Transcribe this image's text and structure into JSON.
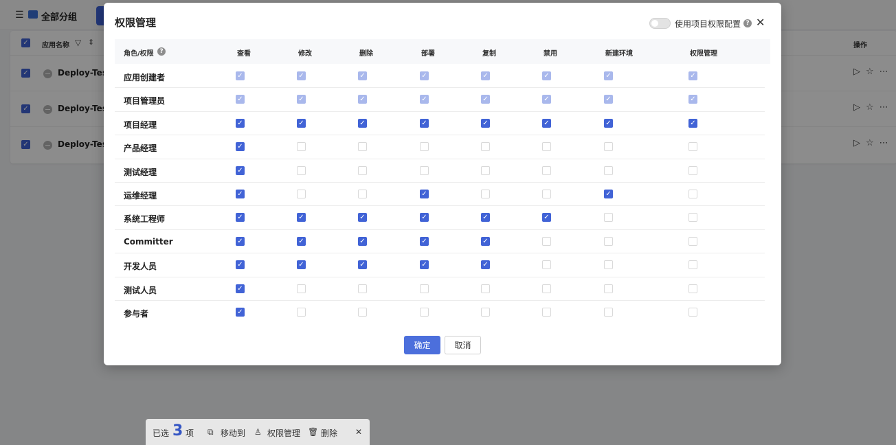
{
  "topbar": {
    "menu_icon": "☰",
    "group_label": "全部分组"
  },
  "list": {
    "col_name": "应用名称",
    "col_ops": "操作",
    "rows": [
      {
        "name": "Deploy-Test"
      },
      {
        "name": "Deploy-Test"
      },
      {
        "name": "Deploy-Test"
      }
    ]
  },
  "dialog": {
    "title": "权限管理",
    "toggle_label": "使用项目权限配置",
    "close_icon": "✕",
    "header_role": "角色/权限",
    "columns": [
      "查看",
      "修改",
      "删除",
      "部署",
      "复制",
      "禁用",
      "新建环境",
      "权限管理"
    ],
    "roles": [
      {
        "name": "应用创建者",
        "state": "disabled",
        "perms": [
          1,
          1,
          1,
          1,
          1,
          1,
          1,
          1
        ]
      },
      {
        "name": "项目管理员",
        "state": "disabled",
        "perms": [
          1,
          1,
          1,
          1,
          1,
          1,
          1,
          1
        ]
      },
      {
        "name": "项目经理",
        "state": "enabled",
        "perms": [
          1,
          1,
          1,
          1,
          1,
          1,
          1,
          1
        ]
      },
      {
        "name": "产品经理",
        "state": "enabled",
        "perms": [
          1,
          0,
          0,
          0,
          0,
          0,
          0,
          0
        ]
      },
      {
        "name": "测试经理",
        "state": "enabled",
        "perms": [
          1,
          0,
          0,
          0,
          0,
          0,
          0,
          0
        ]
      },
      {
        "name": "运维经理",
        "state": "enabled",
        "perms": [
          1,
          0,
          0,
          1,
          0,
          0,
          1,
          0
        ]
      },
      {
        "name": "系统工程师",
        "state": "enabled",
        "perms": [
          1,
          1,
          1,
          1,
          1,
          1,
          0,
          0
        ]
      },
      {
        "name": "Committer",
        "state": "enabled",
        "perms": [
          1,
          1,
          1,
          1,
          1,
          0,
          0,
          0
        ]
      },
      {
        "name": "开发人员",
        "state": "enabled",
        "perms": [
          1,
          1,
          1,
          1,
          1,
          0,
          0,
          0
        ]
      },
      {
        "name": "测试人员",
        "state": "enabled",
        "perms": [
          1,
          0,
          0,
          0,
          0,
          0,
          0,
          0
        ]
      },
      {
        "name": "参与者",
        "state": "enabled",
        "perms": [
          1,
          0,
          0,
          0,
          0,
          0,
          0,
          0
        ]
      }
    ],
    "ok_label": "确定",
    "cancel_label": "取消"
  },
  "selection_bar": {
    "prefix": "已选",
    "count": "3",
    "suffix": "项",
    "move_label": "移动到",
    "perm_label": "权限管理",
    "delete_label": "删除",
    "close_icon": "✕"
  },
  "colors": {
    "primary": "#4163d6",
    "disabled_check": "#a9b8ec"
  }
}
